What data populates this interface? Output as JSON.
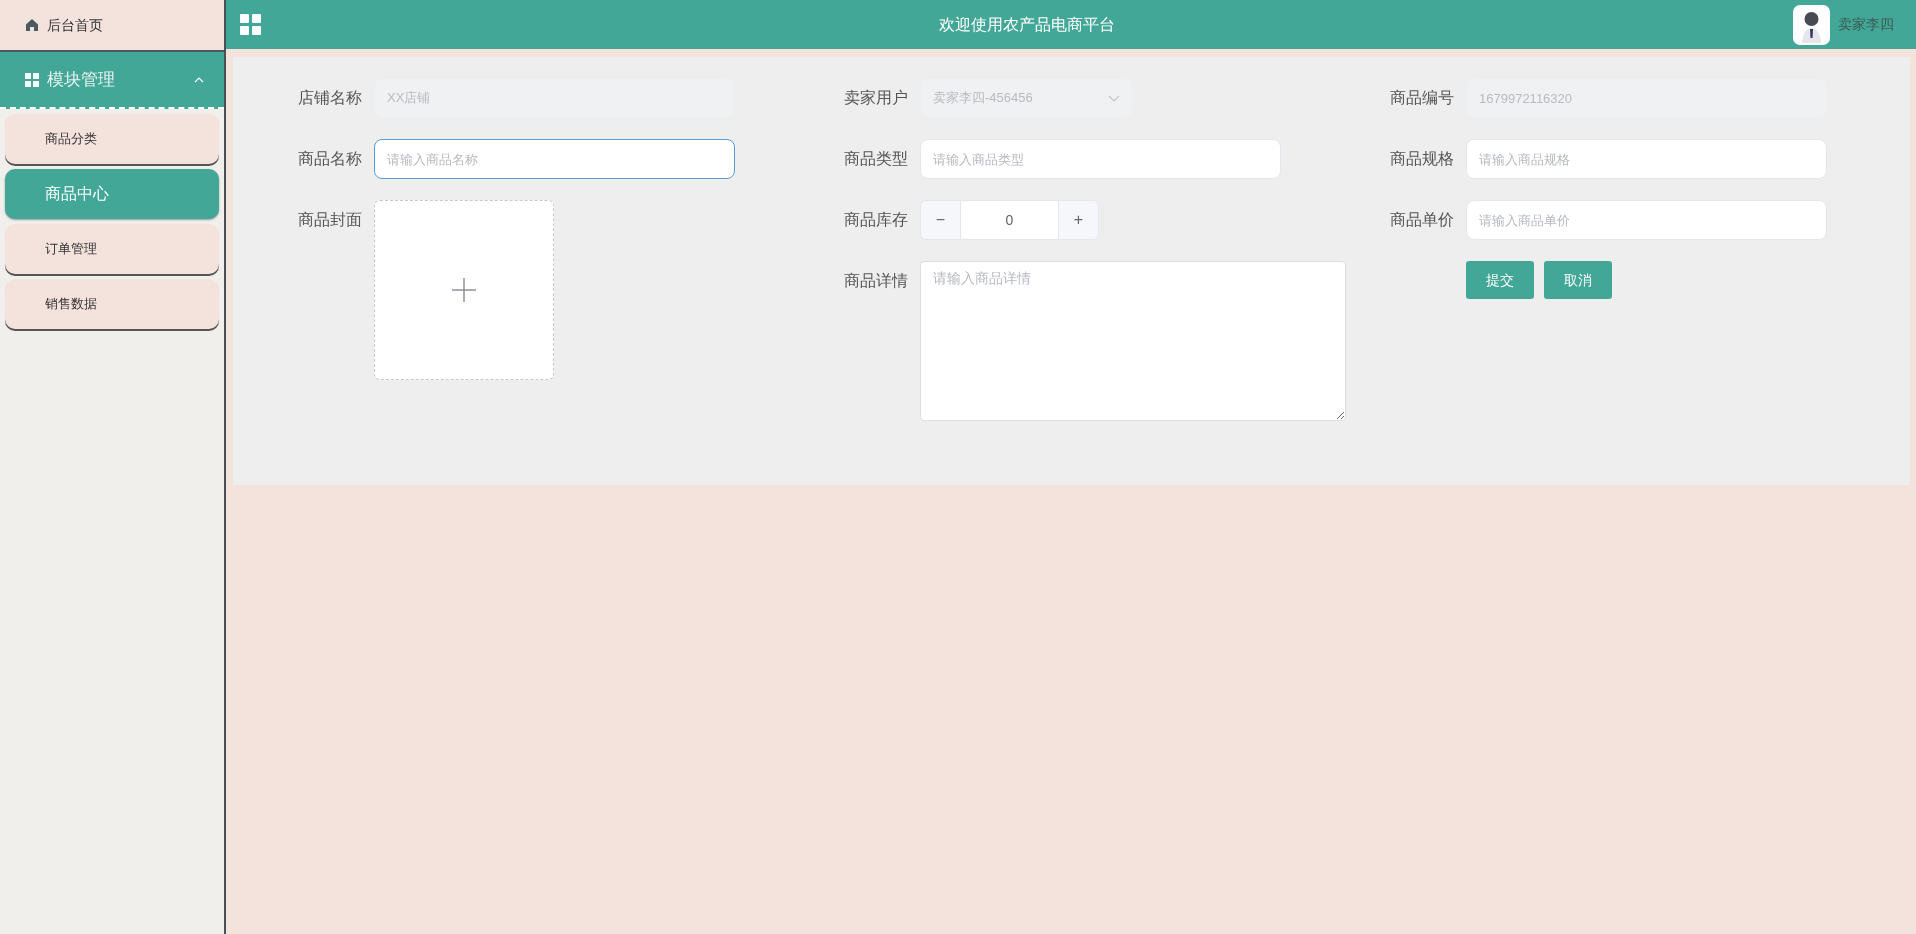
{
  "sidebar": {
    "home": {
      "label": "后台首页"
    },
    "group": {
      "label": "模块管理",
      "expanded": true,
      "items": [
        {
          "label": "商品分类",
          "selected": false
        },
        {
          "label": "商品中心",
          "selected": true
        },
        {
          "label": "订单管理",
          "selected": false
        },
        {
          "label": "销售数据",
          "selected": false
        }
      ]
    }
  },
  "header": {
    "title": "欢迎使用农产品电商平台",
    "user": "卖家李四"
  },
  "form": {
    "columns": [
      [
        {
          "kind": "text",
          "label": "店铺名称",
          "value": "XX店铺",
          "disabled": true,
          "focused": false
        },
        {
          "kind": "text",
          "label": "商品名称",
          "placeholder": "请输入商品名称",
          "disabled": false,
          "focused": true
        },
        {
          "kind": "upload",
          "label": "商品封面"
        }
      ],
      [
        {
          "kind": "select",
          "label": "卖家用户",
          "value": "卖家李四-456456",
          "disabled": true
        },
        {
          "kind": "text",
          "label": "商品类型",
          "placeholder": "请输入商品类型",
          "disabled": false,
          "focused": false
        },
        {
          "kind": "number",
          "label": "商品库存",
          "value": "0",
          "decrement": "−",
          "increment": "+"
        },
        {
          "kind": "textarea",
          "label": "商品详情",
          "placeholder": "请输入商品详情"
        }
      ],
      [
        {
          "kind": "text",
          "label": "商品编号",
          "value": "1679972116320",
          "disabled": true,
          "focused": false
        },
        {
          "kind": "text",
          "label": "商品规格",
          "placeholder": "请输入商品规格",
          "disabled": false,
          "focused": false
        },
        {
          "kind": "text",
          "label": "商品单价",
          "placeholder": "请输入商品单价",
          "disabled": false,
          "focused": false
        },
        {
          "kind": "buttons",
          "buttons": [
            "提交",
            "取消"
          ]
        }
      ]
    ]
  }
}
